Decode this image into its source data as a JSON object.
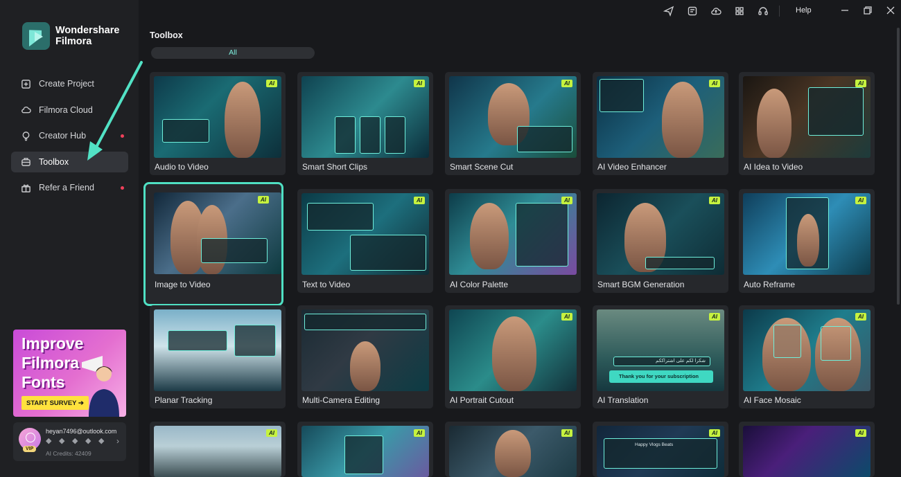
{
  "app": {
    "name": "Wondershare\nFilmora"
  },
  "topbar": {
    "help_label": "Help",
    "icons": [
      "send-icon",
      "notes-icon",
      "cloud-upload-icon",
      "grid-icon",
      "headset-icon"
    ],
    "window_controls": [
      "minimize-icon",
      "restore-icon",
      "close-icon"
    ]
  },
  "sidebar": {
    "items": [
      {
        "label": "Create Project",
        "icon": "plus-square-icon",
        "active": false,
        "dot": false
      },
      {
        "label": "Filmora Cloud",
        "icon": "cloud-icon",
        "active": false,
        "dot": false
      },
      {
        "label": "Creator Hub",
        "icon": "bulb-icon",
        "active": false,
        "dot": true
      },
      {
        "label": "Toolbox",
        "icon": "toolbox-icon",
        "active": true,
        "dot": false
      },
      {
        "label": "Refer a Friend",
        "icon": "gift-icon",
        "active": false,
        "dot": true
      }
    ],
    "promo": {
      "title": "Improve\nFilmora\nFonts",
      "button": "START SURVEY ➔"
    },
    "user": {
      "email": "heyan7496@outlook.com",
      "vip": "VIP",
      "credits": "AI Credits: 42409"
    }
  },
  "main": {
    "section_title": "Toolbox",
    "tabs": [
      {
        "label": "All",
        "active": true
      }
    ],
    "ai_badge": "AI",
    "tools": [
      {
        "label": "Audio to Video",
        "ai": true
      },
      {
        "label": "Smart Short Clips",
        "ai": true
      },
      {
        "label": "Smart Scene Cut",
        "ai": true
      },
      {
        "label": "AI Video Enhancer",
        "ai": true
      },
      {
        "label": "AI Idea to Video",
        "ai": true
      },
      {
        "label": "Image to Video",
        "ai": true,
        "selected": true
      },
      {
        "label": "Text to Video",
        "ai": true
      },
      {
        "label": "AI Color Palette",
        "ai": true
      },
      {
        "label": "Smart BGM Generation",
        "ai": true
      },
      {
        "label": "Auto Reframe",
        "ai": true
      },
      {
        "label": "Planar Tracking",
        "ai": false
      },
      {
        "label": "Multi-Camera Editing",
        "ai": false
      },
      {
        "label": "AI Portrait Cutout",
        "ai": true
      },
      {
        "label": "AI Translation",
        "ai": true
      },
      {
        "label": "AI Face Mosaic",
        "ai": true
      },
      {
        "label": "",
        "ai": true
      },
      {
        "label": "",
        "ai": true
      },
      {
        "label": "",
        "ai": true
      },
      {
        "label": "",
        "ai": true
      },
      {
        "label": "",
        "ai": true
      }
    ],
    "thumb_texts": {
      "translation_banner": "Thank you for your subscription",
      "translation_arabic": "شكرا لكم على اشتراككم",
      "music_title": "Happy Vlogs Beats"
    }
  },
  "colors": {
    "accent": "#4fe0c3",
    "ai_badge": "#c6f23f",
    "notification_dot": "#f0405a"
  }
}
